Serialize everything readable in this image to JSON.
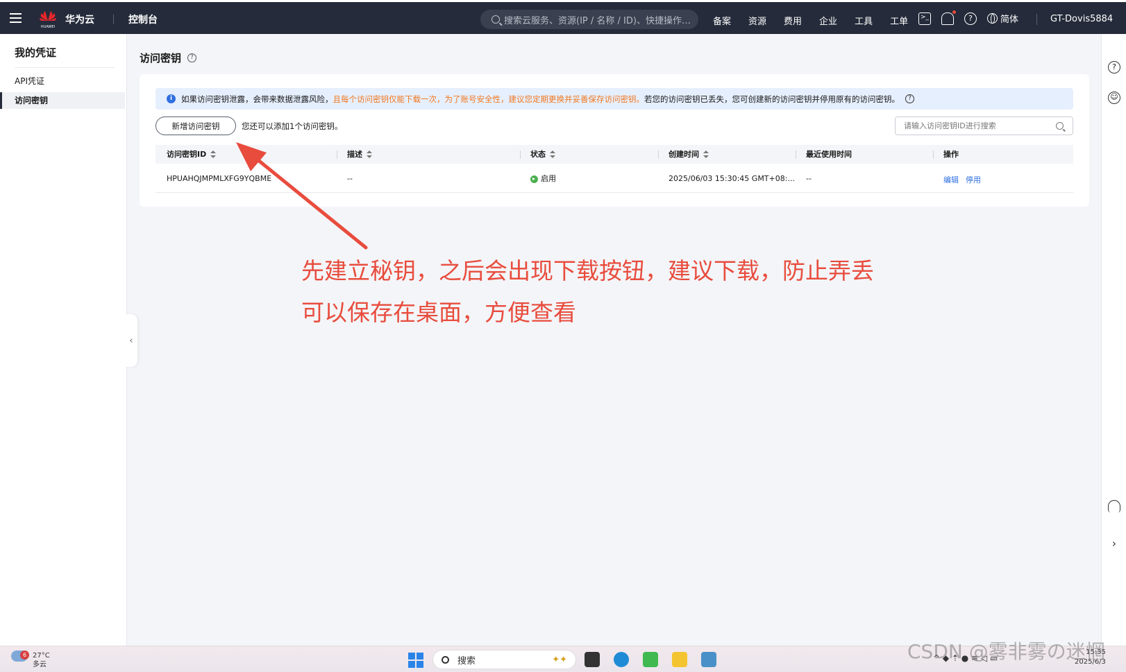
{
  "topbar": {
    "brand": "华为云",
    "console": "控制台",
    "search_placeholder": "搜索云服务、资源(IP / 名称 / ID)、快捷操作…",
    "nav": [
      "备案",
      "资源",
      "费用",
      "企业",
      "工具",
      "工单"
    ],
    "lang": "简体",
    "user": "GT-Dovis5884",
    "icons": [
      "menu-icon",
      "huawei-logo",
      "search-icon",
      "cli-icon",
      "bell-icon",
      "help-icon",
      "globe-icon"
    ]
  },
  "sidebar": {
    "title": "我的凭证",
    "items": [
      {
        "label": "API凭证",
        "active": false
      },
      {
        "label": "访问密钥",
        "active": true
      }
    ]
  },
  "main": {
    "title": "访问密钥",
    "notice": {
      "prefix": "如果访问密钥泄露，会带来数据泄露风险，",
      "warn": "且每个访问密钥仅能下载一次，为了账号安全性，建议您定期更换并妥善保存访问密钥。",
      "suffix": "若您的访问密钥已丢失，您可创建新的访问密钥并停用原有的访问密钥。"
    },
    "add_button": "新增访问密钥",
    "add_hint": "您还可以添加1个访问密钥。",
    "search_placeholder": "请输入访问密钥ID进行搜索",
    "columns": [
      "访问密钥ID",
      "描述",
      "状态",
      "创建时间",
      "最近使用时间",
      "操作"
    ],
    "rows": [
      {
        "id": "HPUAHQJMPMLXFG9YQBME",
        "desc": "--",
        "status": "启用",
        "created": "2025/06/03 15:30:45 GMT+08:...",
        "last_used": "--",
        "actions": [
          "编辑",
          "停用"
        ]
      }
    ]
  },
  "annotation": {
    "line1": "先建立秘钥，之后会出现下载按钮，建议下载，防止弄丢",
    "line2": "可以保存在桌面，方便查看",
    "color": "#e84c3d"
  },
  "taskbar": {
    "badge": "6",
    "temp": "27°C",
    "weather": "多云",
    "search": "搜索",
    "clock_time": "15:35",
    "clock_date": "2025/6/3"
  },
  "watermark": "CSDN @雾非雾の迷惘"
}
